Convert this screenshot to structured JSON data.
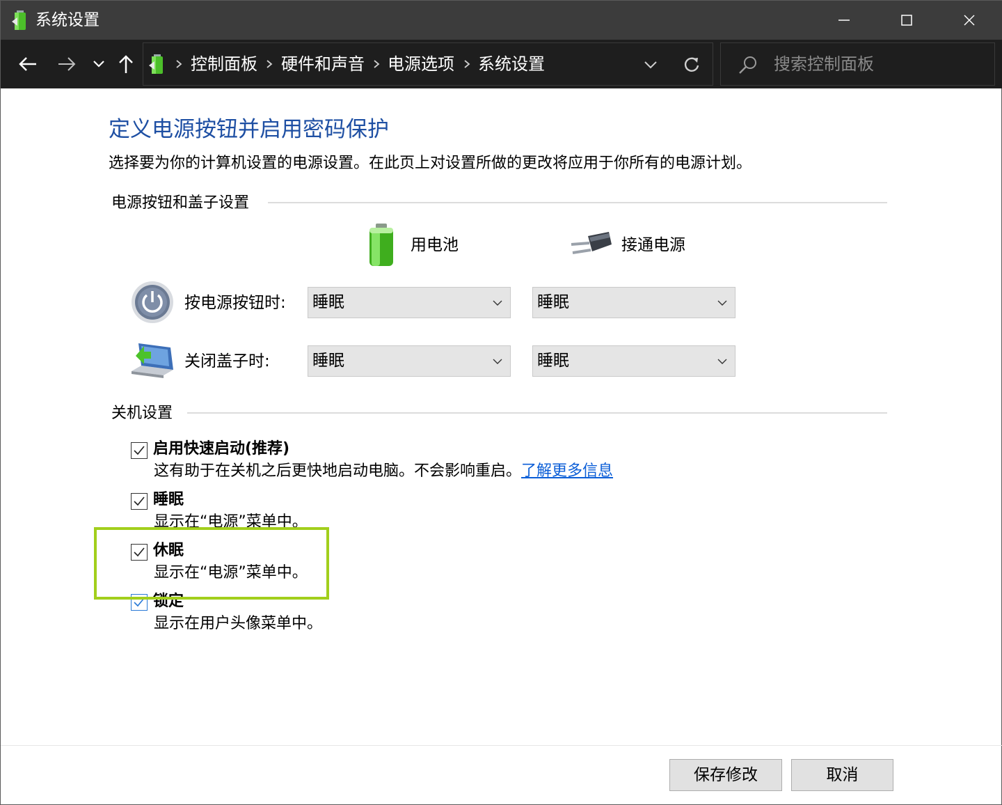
{
  "window": {
    "title": "系统设置",
    "accent": "#1e4fa3",
    "highlight_color": "#a2cf1c"
  },
  "nav": {
    "back_icon": "arrow-left-icon",
    "forward_icon": "arrow-right-icon",
    "recent_icon": "chevron-down-icon",
    "up_icon": "arrow-up-icon",
    "breadcrumbs": [
      "控制面板",
      "硬件和声音",
      "电源选项",
      "系统设置"
    ],
    "search_placeholder": "搜索控制面板"
  },
  "main": {
    "heading": "定义电源按钮并启用密码保护",
    "description": "选择要为你的计算机设置的电源设置。在此页上对设置所做的更改将应用于你所有的电源计划。",
    "power_group": {
      "label": "电源按钮和盖子设置",
      "columns": [
        "用电池",
        "接通电源"
      ],
      "rows": [
        {
          "label": "按电源按钮时:",
          "battery": "睡眠",
          "plugged": "睡眠"
        },
        {
          "label": "关闭盖子时:",
          "battery": "睡眠",
          "plugged": "睡眠"
        }
      ]
    },
    "shutdown_group": {
      "label": "关机设置",
      "options": [
        {
          "title": "启用快速启动(推荐)",
          "desc": "这有助于在关机之后更快地启动电脑。不会影响重启。",
          "link": "了解更多信息",
          "checked": true
        },
        {
          "title": "睡眠",
          "desc": "显示在“电源”菜单中。",
          "checked": true
        },
        {
          "title": "休眠",
          "desc": "显示在“电源”菜单中。",
          "checked": true
        },
        {
          "title": "锁定",
          "desc": "显示在用户头像菜单中。",
          "checked": true
        }
      ]
    }
  },
  "footer": {
    "save_label": "保存修改",
    "cancel_label": "取消"
  }
}
